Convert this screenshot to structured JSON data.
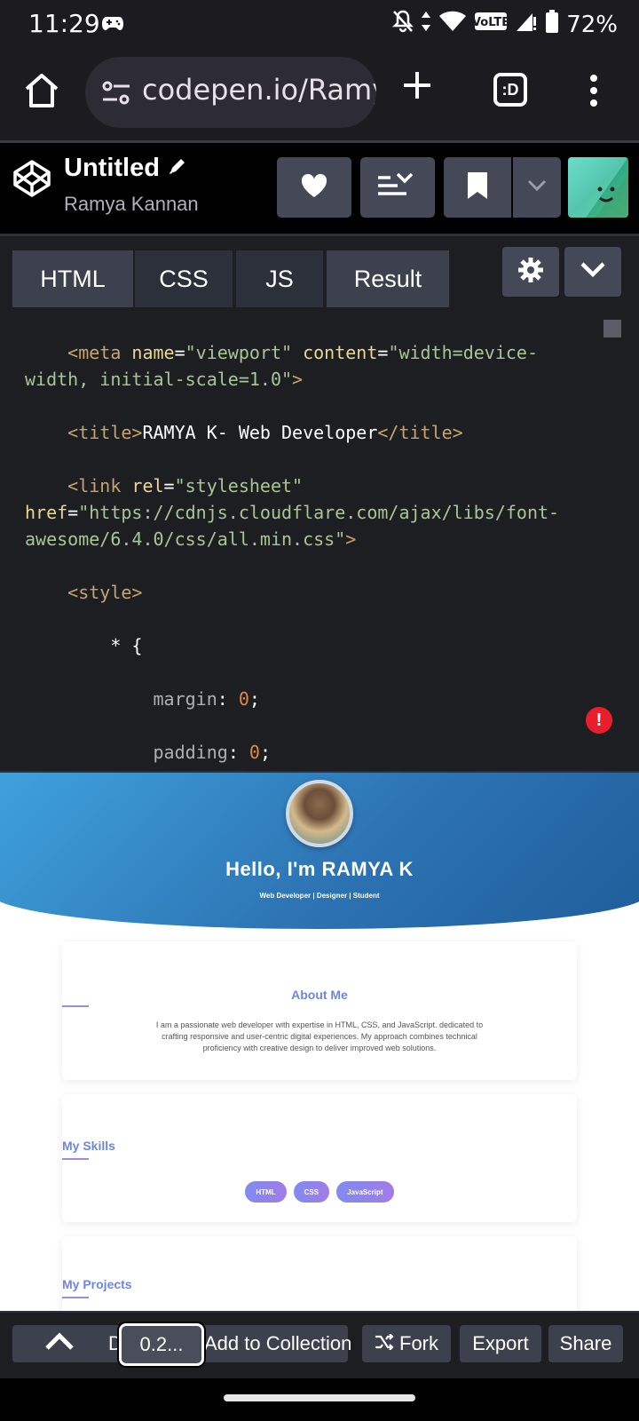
{
  "status_bar": {
    "time": "11:29",
    "battery": "72%",
    "network": "VoLTE"
  },
  "browser": {
    "url": "codepen.io/Ramy",
    "tabs_count": ":D"
  },
  "pen": {
    "title": "Untitled",
    "author": "Ramya Kannan"
  },
  "editor": {
    "tabs": [
      {
        "label": "HTML"
      },
      {
        "label": "CSS"
      },
      {
        "label": "JS"
      },
      {
        "label": "Result"
      }
    ]
  },
  "code": {
    "l1_indent": "    ",
    "l1_open": "<meta ",
    "l1_attr1": "name",
    "l1_eq1": "=",
    "l1_val1": "\"viewport\"",
    "l1_attr2": " content",
    "l1_eq2": "=",
    "l1_val2": "\"width=device-",
    "l2_val": "width, initial-scale=1.0\"",
    "l2_close": ">",
    "l3_open": "<title>",
    "l3_text": "RAMYA K- Web Developer",
    "l3_close": "</title>",
    "l4_open": "<link ",
    "l4_attr": "rel",
    "l4_eq": "=",
    "l4_val": "\"stylesheet\"",
    "l5_attr": "href",
    "l5_eq": "=",
    "l5_val": "\"https://cdnjs.cloudflare.com/ajax/libs/font-",
    "l6_val": "awesome/6.4.0/css/all.min.css\"",
    "l6_close": ">",
    "l7_open": "<style>",
    "l8_sel": "* {",
    "l9_prop": "margin",
    "l9_colon": ": ",
    "l9_val": "0",
    "l9_semi": ";",
    "l10_prop": "padding",
    "l10_colon": ": ",
    "l10_val": "0",
    "l10_semi": ";"
  },
  "preview": {
    "hero_title": "Hello, I'm RAMYA K",
    "hero_subtitle": "Web Developer | Designer | Student",
    "about_title": "About Me",
    "about_text": "I am a passionate web developer with expertise in HTML, CSS, and JavaScript. dedicated to crafting responsive and user-centric digital experiences. My approach combines technical proficiency with creative design to deliver improved web solutions.",
    "skills_title": "My Skills",
    "skills": [
      "HTML",
      "CSS",
      "JavaScript"
    ],
    "projects_title": "My Projects"
  },
  "toolbar": {
    "d_label": "D",
    "console_label": "0.2...",
    "collection_label": "Add to Collection",
    "fork_label": "Fork",
    "export_label": "Export",
    "share_label": "Share"
  },
  "colors": {
    "accent_link": "#6d85e6",
    "error": "#e81e2c",
    "hero_start": "#3fa3dd",
    "hero_end": "#1f5d9a"
  }
}
